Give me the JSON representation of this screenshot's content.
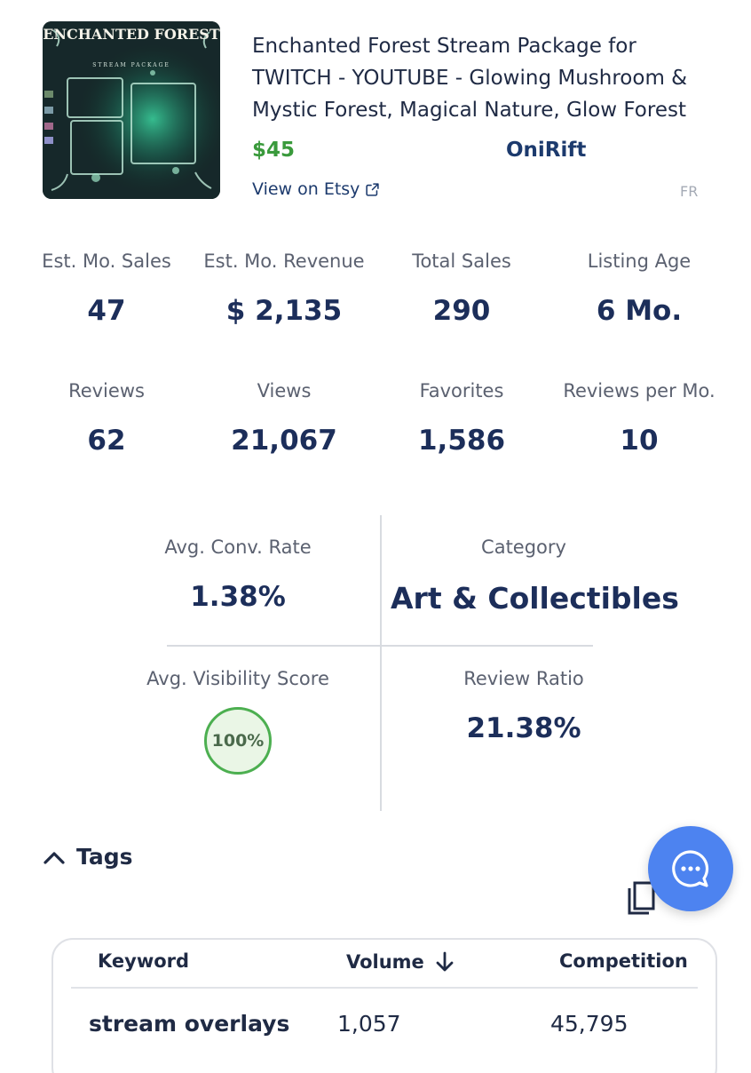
{
  "listing": {
    "image_title": "ENCHANTED FOREST",
    "image_subtitle": "STREAM PACKAGE",
    "title": "Enchanted Forest Stream Package for TWITCH - YOUTUBE - Glowing Mushroom & Mystic Forest, Magical Nature, Glow Forest",
    "price": "$45",
    "shop": "OniRift",
    "view_link": "View on Etsy",
    "country": "FR"
  },
  "stats": [
    {
      "label": "Est. Mo. Sales",
      "value": "47"
    },
    {
      "label": "Est. Mo. Revenue",
      "value": "$ 2,135"
    },
    {
      "label": "Total Sales",
      "value": "290"
    },
    {
      "label": "Listing Age",
      "value": "6 Mo."
    },
    {
      "label": "Reviews",
      "value": "62"
    },
    {
      "label": "Views",
      "value": "21,067"
    },
    {
      "label": "Favorites",
      "value": "1,586"
    },
    {
      "label": "Reviews per Mo.",
      "value": "10"
    }
  ],
  "metrics": {
    "conv_rate": {
      "label": "Avg. Conv. Rate",
      "value": "1.38%"
    },
    "category": {
      "label": "Category",
      "value": "Art & Collectibles"
    },
    "visibility": {
      "label": "Avg. Visibility Score",
      "value": "100%"
    },
    "review_ratio": {
      "label": "Review Ratio",
      "value": "21.38%"
    }
  },
  "tags": {
    "section_label": "Tags",
    "columns": {
      "keyword": "Keyword",
      "volume": "Volume",
      "competition": "Competition"
    },
    "rows": [
      {
        "keyword": "stream overlays",
        "volume": "1,057",
        "competition": "45,795"
      }
    ]
  },
  "icons": {
    "collapse": "chevron-up-icon",
    "external": "external-link-icon",
    "sort": "arrow-down-icon",
    "copy": "copy-icon",
    "chat": "chat-bubble-icon"
  },
  "colors": {
    "price": "#3a9a3c",
    "link": "#1c3a6d",
    "value": "#1c2e5a",
    "chat": "#4d83f0",
    "score_ring": "#4caf50"
  }
}
